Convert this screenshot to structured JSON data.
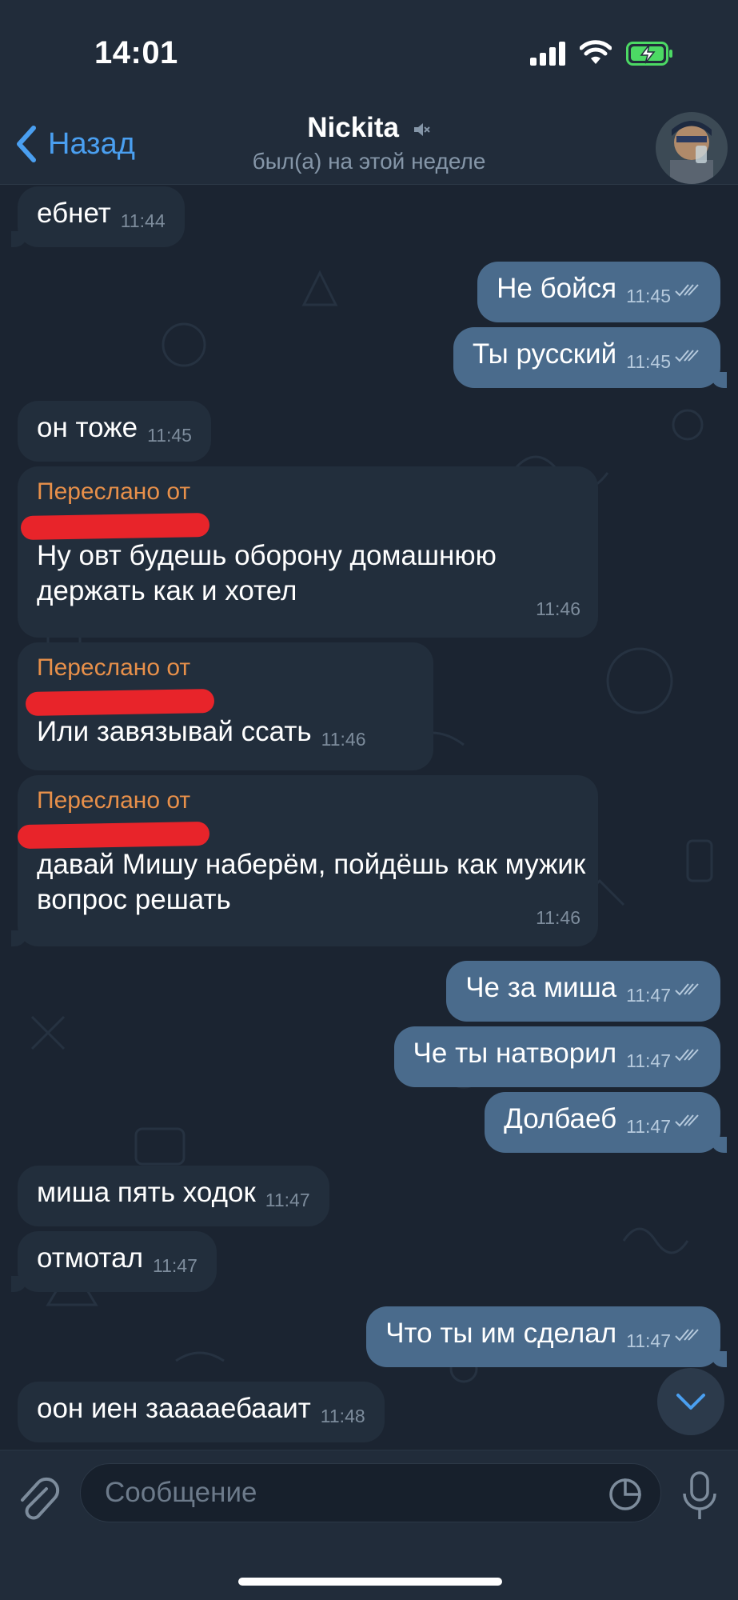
{
  "status_bar": {
    "time": "14:01"
  },
  "header": {
    "back_label": "Назад",
    "title": "Nickita",
    "subtitle": "был(а) на этой неделе"
  },
  "messages": [
    {
      "text": "ебнет",
      "time": "11:44",
      "dir": "in"
    },
    {
      "text": "Не бойся",
      "time": "11:45",
      "dir": "out"
    },
    {
      "text": "Ты русский",
      "time": "11:45",
      "dir": "out"
    },
    {
      "text": "он тоже",
      "time": "11:45",
      "dir": "in"
    },
    {
      "forwarded_label": "Переслано от",
      "text": "Ну овт будешь оборону домашнюю держать как и хотел",
      "time": "11:46",
      "dir": "in"
    },
    {
      "forwarded_label": "Переслано от",
      "text": "Или завязывай ссать",
      "time": "11:46",
      "dir": "in"
    },
    {
      "forwarded_label": "Переслано от",
      "text": "давай Мишу наберём, пойдёшь как мужик вопрос решать",
      "time": "11:46",
      "dir": "in"
    },
    {
      "text": "Че за миша",
      "time": "11:47",
      "dir": "out"
    },
    {
      "text": "Че ты натворил",
      "time": "11:47",
      "dir": "out"
    },
    {
      "text": "Долбаеб",
      "time": "11:47",
      "dir": "out"
    },
    {
      "text": "миша пять ходок",
      "time": "11:47",
      "dir": "in"
    },
    {
      "text": "отмотал",
      "time": "11:47",
      "dir": "in"
    },
    {
      "text": "Что ты им сделал",
      "time": "11:47",
      "dir": "out"
    },
    {
      "text": "оон иен зааааебааит",
      "time": "11:48",
      "dir": "in"
    }
  ],
  "input": {
    "placeholder": "Сообщение"
  },
  "colors": {
    "accent": "#4a9ff0",
    "outgoing_bubble": "#4a6b8c",
    "incoming_bubble": "#222e3c",
    "forward_label": "#e8904a",
    "redaction": "#e8242a"
  },
  "icons": [
    "back-chevron-icon",
    "mute-icon",
    "signal-icon",
    "wifi-icon",
    "battery-charging-icon",
    "read-checks-icon",
    "chevron-down-icon",
    "paperclip-icon",
    "sticker-icon",
    "microphone-icon"
  ]
}
